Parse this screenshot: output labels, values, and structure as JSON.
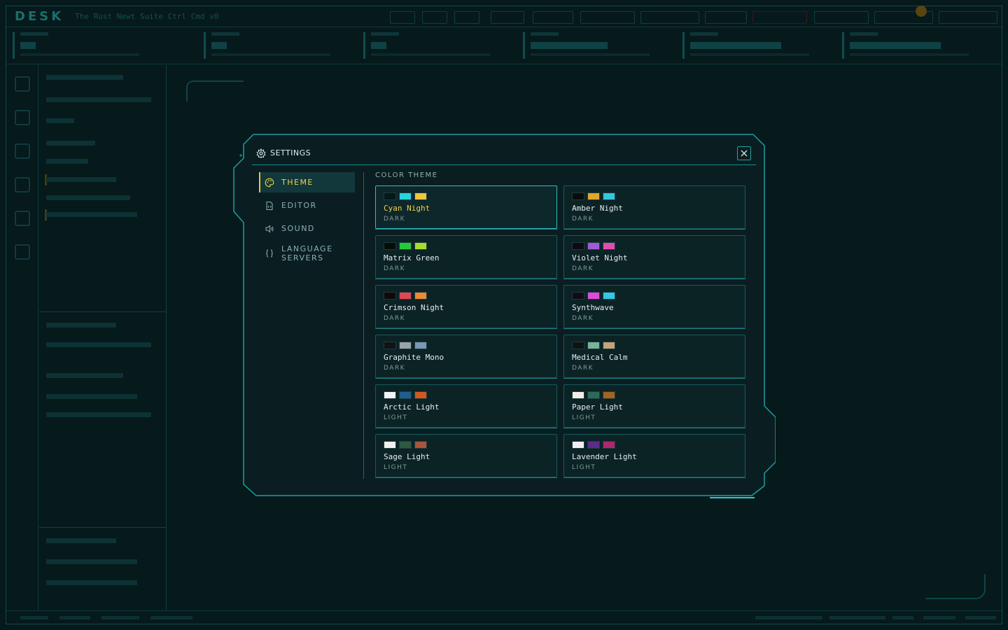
{
  "app": {
    "logo": "DESK",
    "tagline": "The Rust Newt Suite Ctrl Cmd v0"
  },
  "modal": {
    "title": "SETTINGS",
    "close_label": "✕"
  },
  "nav": {
    "items": [
      {
        "label": "THEME",
        "icon": "palette-icon",
        "active": true
      },
      {
        "label": "EDITOR",
        "icon": "file-code-icon",
        "active": false
      },
      {
        "label": "SOUND",
        "icon": "speaker-icon",
        "active": false
      },
      {
        "label": "LANGUAGE\nSERVERS",
        "icon": "braces-icon",
        "active": false
      }
    ]
  },
  "theme_section": {
    "title": "COLOR THEME",
    "themes": [
      {
        "name": "Cyan Night",
        "mode": "DARK",
        "selected": true,
        "swatches": [
          "#05181a",
          "#27d4e0",
          "#ecc73a"
        ]
      },
      {
        "name": "Amber Night",
        "mode": "DARK",
        "selected": false,
        "swatches": [
          "#0b0b0b",
          "#e6a52a",
          "#35c6df"
        ]
      },
      {
        "name": "Matrix Green",
        "mode": "DARK",
        "selected": false,
        "swatches": [
          "#060d07",
          "#26c93d",
          "#a8dc2c"
        ]
      },
      {
        "name": "Violet Night",
        "mode": "DARK",
        "selected": false,
        "swatches": [
          "#0d0a12",
          "#a25ad8",
          "#e04db0"
        ]
      },
      {
        "name": "Crimson Night",
        "mode": "DARK",
        "selected": false,
        "swatches": [
          "#100809",
          "#e04655",
          "#ec8a32"
        ]
      },
      {
        "name": "Synthwave",
        "mode": "DARK",
        "selected": false,
        "swatches": [
          "#120a18",
          "#e04ad8",
          "#32c8e8"
        ]
      },
      {
        "name": "Graphite Mono",
        "mode": "DARK",
        "selected": false,
        "swatches": [
          "#111314",
          "#9aa3a8",
          "#7b97b4"
        ]
      },
      {
        "name": "Medical Calm",
        "mode": "DARK",
        "selected": false,
        "swatches": [
          "#0d1313",
          "#78b39a",
          "#c5a27a"
        ]
      },
      {
        "name": "Arctic Light",
        "mode": "LIGHT",
        "selected": false,
        "swatches": [
          "#f2f5f7",
          "#1c5f8f",
          "#d2581e"
        ]
      },
      {
        "name": "Paper Light",
        "mode": "LIGHT",
        "selected": false,
        "swatches": [
          "#f3efe6",
          "#2c6a57",
          "#a8621e"
        ]
      },
      {
        "name": "Sage Light",
        "mode": "LIGHT",
        "selected": false,
        "swatches": [
          "#eef1ee",
          "#2c5a40",
          "#a8553a"
        ]
      },
      {
        "name": "Lavender Light",
        "mode": "LIGHT",
        "selected": false,
        "swatches": [
          "#f1eef5",
          "#5b2c8a",
          "#b02670"
        ]
      }
    ]
  },
  "colors": {
    "accent_cyan": "#2fbfc3",
    "accent_amber": "#f2d04a",
    "panel_bg": "#0a1e21"
  }
}
